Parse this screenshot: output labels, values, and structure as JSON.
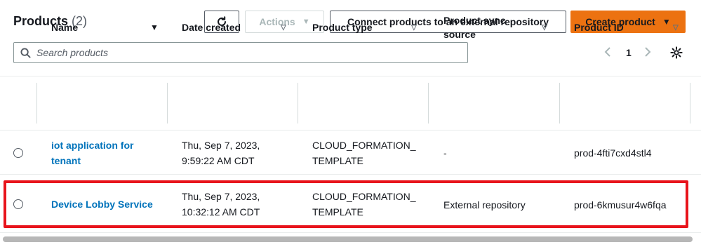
{
  "header": {
    "title": "Products",
    "count": "(2)",
    "refresh_icon": "refresh-icon",
    "actions_label": "Actions",
    "connect_label": "Connect products to an external repository",
    "create_label": "Create product"
  },
  "search": {
    "placeholder": "Search products",
    "value": ""
  },
  "pagination": {
    "current_page": "1"
  },
  "table": {
    "columns": [
      "Name",
      "Date created",
      "Product type",
      "Product sync source",
      "Product ID"
    ],
    "rows": [
      {
        "name_line1": "iot application for",
        "name_line2": "tenant",
        "date_line1": "Thu, Sep 7, 2023,",
        "date_line2": "9:59:22 AM CDT",
        "type_line1": "CLOUD_FORMATION_",
        "type_line2": "TEMPLATE",
        "sync_source": "-",
        "product_id": "prod-4fti7cxd4stl4"
      },
      {
        "name_line1": "Device Lobby Service",
        "name_line2": "",
        "date_line1": "Thu, Sep 7, 2023,",
        "date_line2": "10:32:12 AM CDT",
        "type_line1": "CLOUD_FORMATION_",
        "type_line2": "TEMPLATE",
        "sync_source": "External repository",
        "product_id": "prod-6kmusur4w6fqa"
      }
    ]
  },
  "colors": {
    "primary_button": "#ec7211",
    "link": "#0073bb",
    "highlight_box": "#e8141c"
  }
}
